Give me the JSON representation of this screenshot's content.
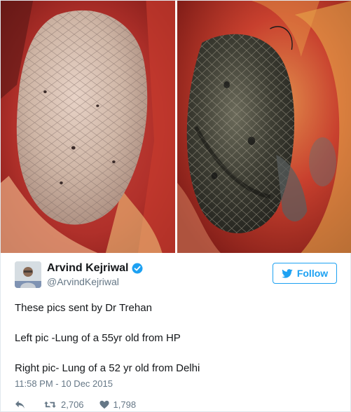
{
  "tweet": {
    "author": {
      "display_name": "Arvind Kejriwal",
      "handle": "@ArvindKejriwal",
      "verified": true
    },
    "follow_label": "Follow",
    "text_lines": [
      "These pics sent by Dr Trehan",
      "Left pic -Lung of a 55yr old from HP",
      "Right pic- Lung of a 52 yr old from Delhi"
    ],
    "timestamp": "11:58 PM - 10 Dec 2015",
    "stats": {
      "retweets": "2,706",
      "likes": "1,798"
    },
    "colors": {
      "accent": "#1da1f2",
      "muted": "#657786"
    },
    "icons": [
      "reply-icon",
      "retweet-icon",
      "like-icon",
      "verified-badge-icon",
      "twitter-bird-icon"
    ]
  }
}
